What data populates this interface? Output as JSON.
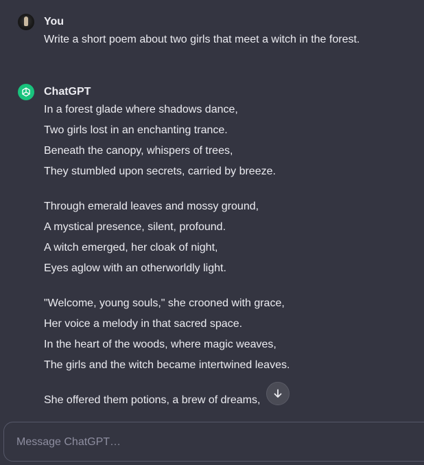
{
  "user_message": {
    "author": "You",
    "text": "Write a short poem about two girls that meet a witch in the forest."
  },
  "assistant_message": {
    "author": "ChatGPT",
    "stanzas": [
      [
        "In a forest glade where shadows dance,",
        "Two girls lost in an enchanting trance.",
        "Beneath the canopy, whispers of trees,",
        "They stumbled upon secrets, carried by breeze."
      ],
      [
        "Through emerald leaves and mossy ground,",
        "A mystical presence, silent, profound.",
        "A witch emerged, her cloak of night,",
        "Eyes aglow with an otherworldly light."
      ],
      [
        "\"Welcome, young souls,\" she crooned with grace,",
        "Her voice a melody in that sacred space.",
        "In the heart of the woods, where magic weaves,",
        "The girls and the witch became intertwined leaves."
      ],
      [
        "She offered them potions, a brew of dreams,"
      ]
    ]
  },
  "composer": {
    "placeholder": "Message ChatGPT…"
  },
  "icons": {
    "user_avatar": "user-avatar-photo",
    "bot_avatar": "openai-logo-icon",
    "scroll_down": "arrow-down-icon"
  },
  "colors": {
    "background": "#343541",
    "text": "#ececf1",
    "bot_avatar_bg": "#19c37d",
    "border": "#565869",
    "placeholder": "#8e8ea0"
  }
}
